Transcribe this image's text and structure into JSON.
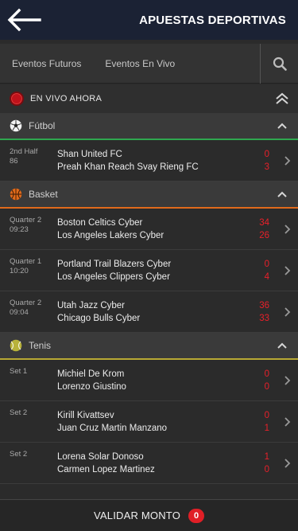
{
  "header": {
    "title": "APUESTAS DEPORTIVAS",
    "back_icon": "arrow-left-icon"
  },
  "tabs": [
    {
      "label": "Eventos Futuros"
    },
    {
      "label": "Eventos En Vivo"
    }
  ],
  "search_icon": "search-icon",
  "live": {
    "label": "EN VIVO AHORA",
    "accent": "#c0121b"
  },
  "sports": [
    {
      "name": "Fútbol",
      "accent": "#2fa84f",
      "icon": "soccer-ball-icon",
      "matches": [
        {
          "period": "2nd Half",
          "time": "86",
          "home": "Shan United FC",
          "away": "Preah Khan Reach Svay Rieng FC",
          "home_score": "0",
          "away_score": "3"
        }
      ]
    },
    {
      "name": "Basket",
      "accent": "#e06a1b",
      "icon": "basketball-icon",
      "matches": [
        {
          "period": "Quarter 2",
          "time": "09:23",
          "home": "Boston Celtics Cyber",
          "away": "Los Angeles Lakers Cyber",
          "home_score": "34",
          "away_score": "26"
        },
        {
          "period": "Quarter 1",
          "time": "10:20",
          "home": "Portland Trail Blazers Cyber",
          "away": "Los Angeles Clippers Cyber",
          "home_score": "0",
          "away_score": "4"
        },
        {
          "period": "Quarter 2",
          "time": "09:04",
          "home": "Utah Jazz Cyber",
          "away": "Chicago Bulls Cyber",
          "home_score": "36",
          "away_score": "33"
        }
      ]
    },
    {
      "name": "Tenis",
      "accent": "#b8a934",
      "icon": "tennis-ball-icon",
      "matches": [
        {
          "period": "Set 1",
          "time": "",
          "home": "Michiel De Krom",
          "away": "Lorenzo Giustino",
          "home_score": "0",
          "away_score": "0"
        },
        {
          "period": "Set 2",
          "time": "",
          "home": "Kirill Kivattsev",
          "away": "Juan Cruz Martin Manzano",
          "home_score": "0",
          "away_score": "1"
        },
        {
          "period": "Set 2",
          "time": "",
          "home": "Lorena Solar Donoso",
          "away": "Carmen Lopez Martinez",
          "home_score": "1",
          "away_score": "0"
        }
      ]
    }
  ],
  "footer": {
    "label": "VALIDAR MONTO",
    "count": "0"
  }
}
